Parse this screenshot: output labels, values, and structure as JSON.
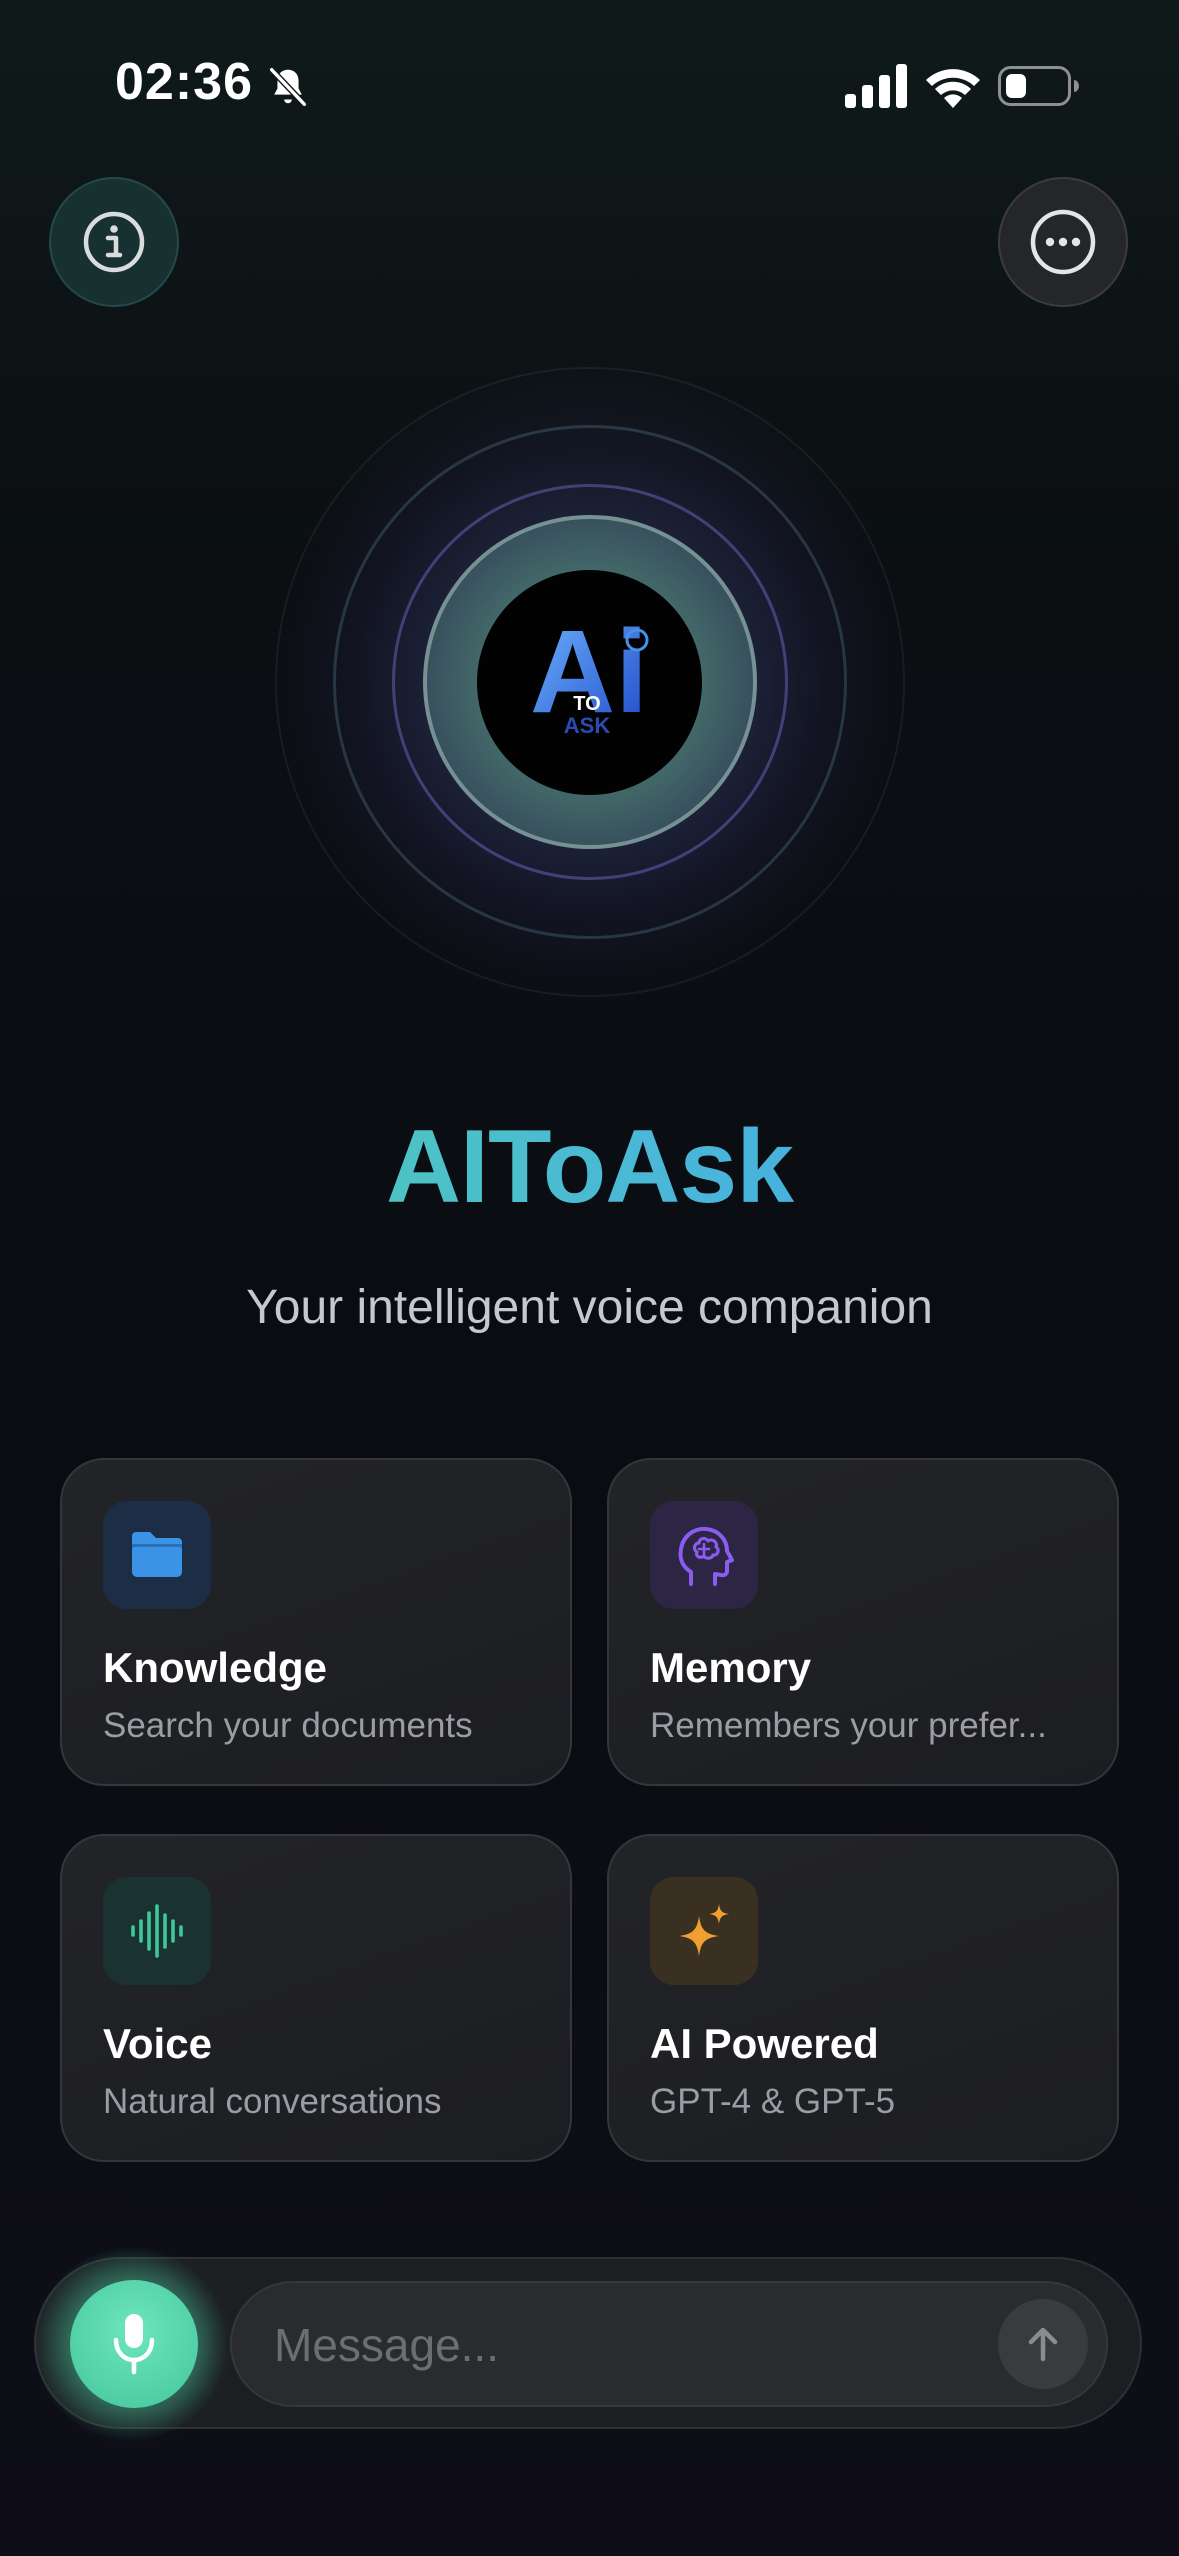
{
  "status_bar": {
    "time": "02:36",
    "icons": [
      "bell-muted-icon",
      "cellular-signal-icon",
      "wifi-icon",
      "battery-icon"
    ]
  },
  "header": {
    "info_icon": "info-icon",
    "more_icon": "more-dots-icon"
  },
  "hero": {
    "logo_main": "Ai",
    "logo_small_1": "TO",
    "logo_small_2": "ASK",
    "title": "AIToAsk",
    "subtitle": "Your intelligent voice companion"
  },
  "features": [
    {
      "title": "Knowledge",
      "description": "Search your documents",
      "icon": "folder-icon",
      "color": "#3b93e6"
    },
    {
      "title": "Memory",
      "description": "Remembers your prefer...",
      "icon": "brain-head-icon",
      "color": "#8a5cf0"
    },
    {
      "title": "Voice",
      "description": "Natural conversations",
      "icon": "waveform-icon",
      "color": "#3ec79a"
    },
    {
      "title": "AI Powered",
      "description": "GPT-4 & GPT-5",
      "icon": "sparkles-icon",
      "color": "#f0a030"
    }
  ],
  "composer": {
    "placeholder": "Message...",
    "mic_icon": "microphone-icon",
    "send_icon": "arrow-up-icon"
  },
  "colors": {
    "accent_green": "#4fd3a8",
    "accent_blue": "#3f9ff0",
    "background": "#0b0f12"
  }
}
